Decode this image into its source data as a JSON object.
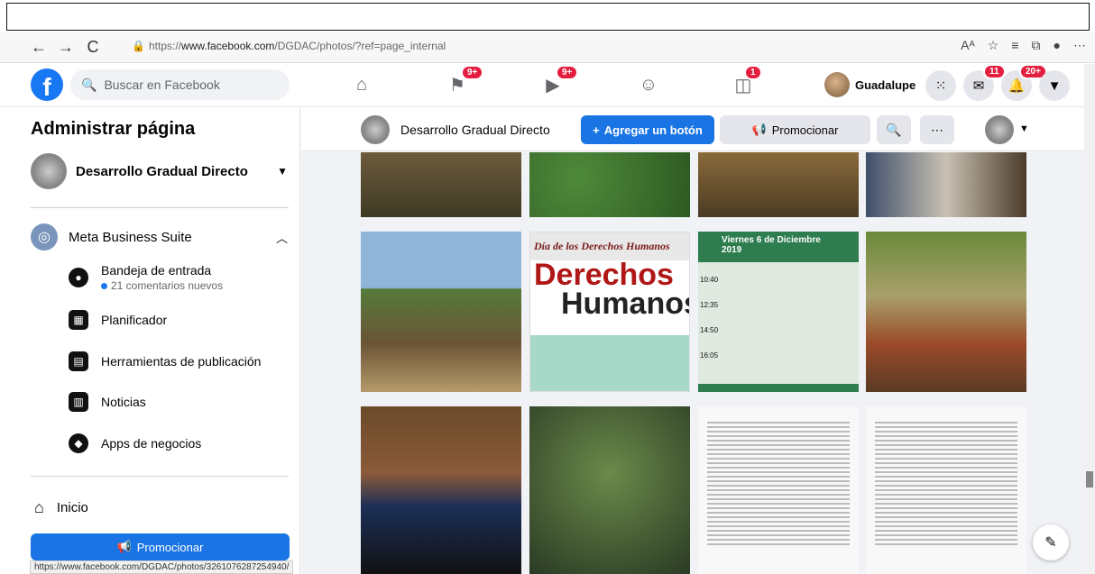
{
  "browser": {
    "url_prefix": "https://",
    "url_domain": "www.facebook.com",
    "url_path": "/DGDAC/photos/?ref=page_internal",
    "back": "←",
    "forward": "→",
    "reload": "C"
  },
  "fb_header": {
    "logo": "f",
    "search_placeholder": "Buscar en Facebook",
    "badges": {
      "flag": "9+",
      "video": "9+",
      "gaming": "1",
      "messenger": "11",
      "notifications": "20+"
    },
    "user_name": "Guadalupe"
  },
  "sidebar": {
    "title": "Administrar página",
    "page_name": "Desarrollo Gradual Directo",
    "meta_label": "Meta Business Suite",
    "items": [
      {
        "label": "Bandeja de entrada",
        "sub": "21 comentarios nuevos",
        "icon": "chat-icon"
      },
      {
        "label": "Planificador",
        "icon": "calendar-icon"
      },
      {
        "label": "Herramientas de publicación",
        "icon": "tools-icon"
      },
      {
        "label": "Noticias",
        "icon": "news-icon"
      },
      {
        "label": "Apps de negocios",
        "icon": "cube-icon"
      }
    ],
    "inicio": "Inicio",
    "promo_label": "Promocionar"
  },
  "page_bar": {
    "name": "Desarrollo Gradual Directo",
    "add_button": "Agregar un botón",
    "promo_button": "Promocionar"
  },
  "photos": {
    "poster_title": "Día de los Derechos Humanos",
    "poster_word1": "Derechos",
    "poster_word2": "Humanos",
    "event_title": "Viernes 6 de Diciembre 2019",
    "event_times": [
      "10:40",
      "12:35",
      "14:50",
      "16:05"
    ]
  },
  "status_url": "https://www.facebook.com/DGDAC/photos/3261076287254940/",
  "colors": {
    "brand": "#1877f2",
    "badge": "#e41e3f",
    "button": "#1b74e4"
  }
}
